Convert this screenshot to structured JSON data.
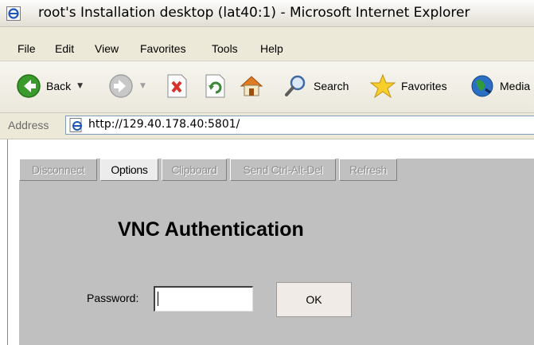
{
  "window": {
    "title": "root's Installation desktop (lat40:1) - Microsoft Internet Explorer",
    "icon": "ie-icon"
  },
  "menu": {
    "items": [
      "File",
      "Edit",
      "View",
      "Favorites",
      "Tools",
      "Help"
    ]
  },
  "toolbar": {
    "back_label": "Back",
    "search_label": "Search",
    "favorites_label": "Favorites",
    "media_label": "Media"
  },
  "address": {
    "label": "Address",
    "url": "http://129.40.178.40:5801/"
  },
  "vnc": {
    "buttons": [
      {
        "label": "Disconnect",
        "enabled": false
      },
      {
        "label": "Options",
        "enabled": true
      },
      {
        "label": "Clipboard",
        "enabled": false
      },
      {
        "label": "Send Ctrl-Alt-Del",
        "enabled": false
      },
      {
        "label": "Refresh",
        "enabled": false
      }
    ],
    "title": "VNC Authentication",
    "password_label": "Password:",
    "password_value": "",
    "ok_label": "OK"
  },
  "colors": {
    "applet_bg": "#c0c0c0",
    "back_arrow": "#3a9a2b",
    "stop_x": "#d8322a",
    "refresh": "#3a8a35"
  }
}
